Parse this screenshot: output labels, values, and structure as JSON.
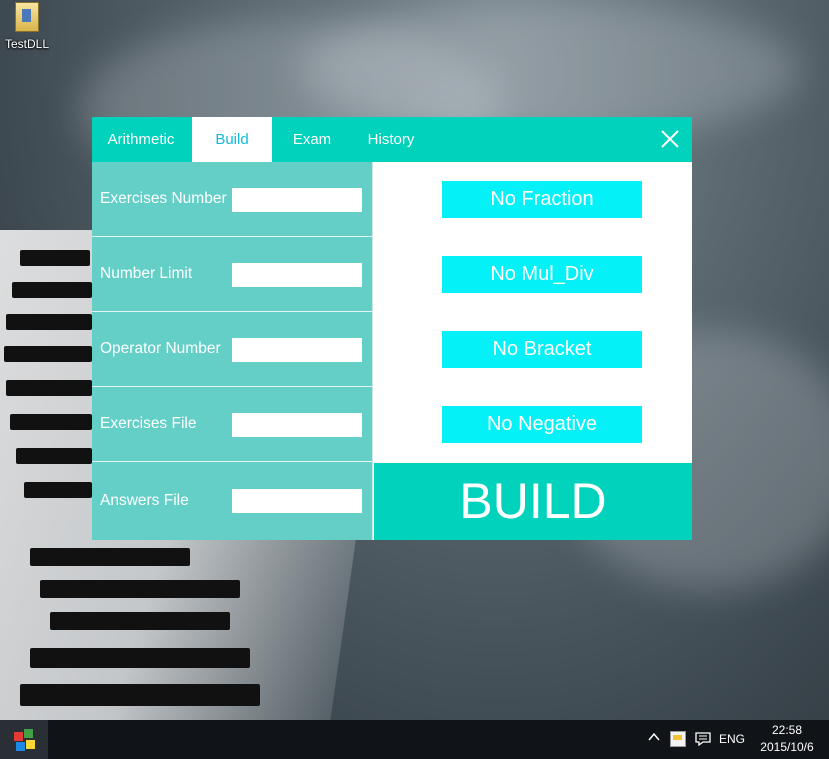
{
  "desktop": {
    "icons": [
      {
        "label": "TestDLL"
      }
    ]
  },
  "window": {
    "tabs": [
      {
        "label": "Arithmetic"
      },
      {
        "label": "Build"
      },
      {
        "label": "Exam"
      },
      {
        "label": "History"
      }
    ],
    "active_tab": "Build",
    "accent_color": "#00d2bc",
    "fields": [
      {
        "label": "Exercises Number",
        "value": ""
      },
      {
        "label": "Number Limit",
        "value": ""
      },
      {
        "label": "Operator Number",
        "value": ""
      },
      {
        "label": "Exercises File",
        "value": ""
      },
      {
        "label": "Answers File",
        "value": ""
      }
    ],
    "options": [
      {
        "label": "No Fraction"
      },
      {
        "label": "No Mul_Div"
      },
      {
        "label": "No Bracket"
      },
      {
        "label": "No Negative"
      }
    ],
    "build_label": "BUILD"
  },
  "taskbar": {
    "language": "ENG",
    "time": "22:58",
    "date": "2015/10/6"
  }
}
